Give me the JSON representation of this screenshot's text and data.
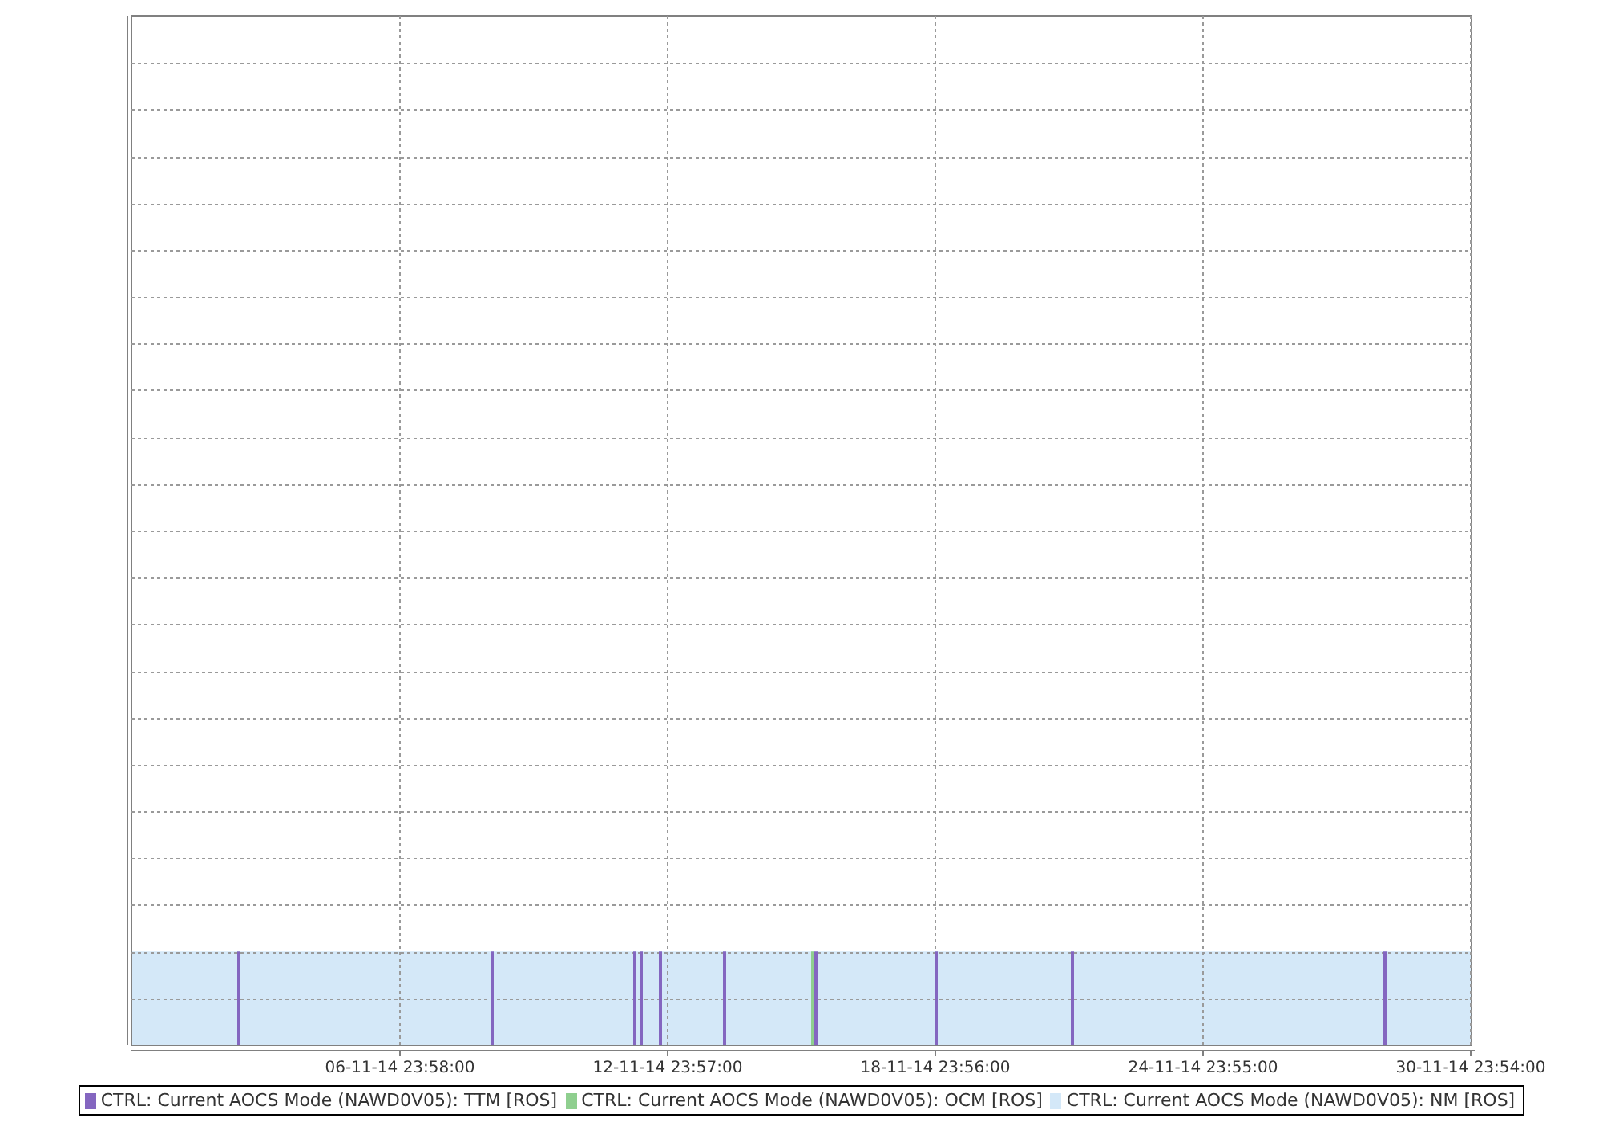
{
  "chart": {
    "x_tick_labels": [
      "06-11-14 23:58:00",
      "12-11-14 23:57:00",
      "18-11-14 23:56:00",
      "24-11-14 23:55:00",
      "30-11-14 23:54:00"
    ]
  },
  "legend": [
    {
      "label": "CTRL: Current AOCS Mode (NAWD0V05): TTM [ROS]",
      "color": "#8466c0"
    },
    {
      "label": "CTRL: Current AOCS Mode (NAWD0V05): OCM [ROS]",
      "color": "#8fcf8f"
    },
    {
      "label": "CTRL: Current AOCS Mode (NAWD0V05): NM [ROS]",
      "color": "#d4e8f8"
    }
  ]
}
